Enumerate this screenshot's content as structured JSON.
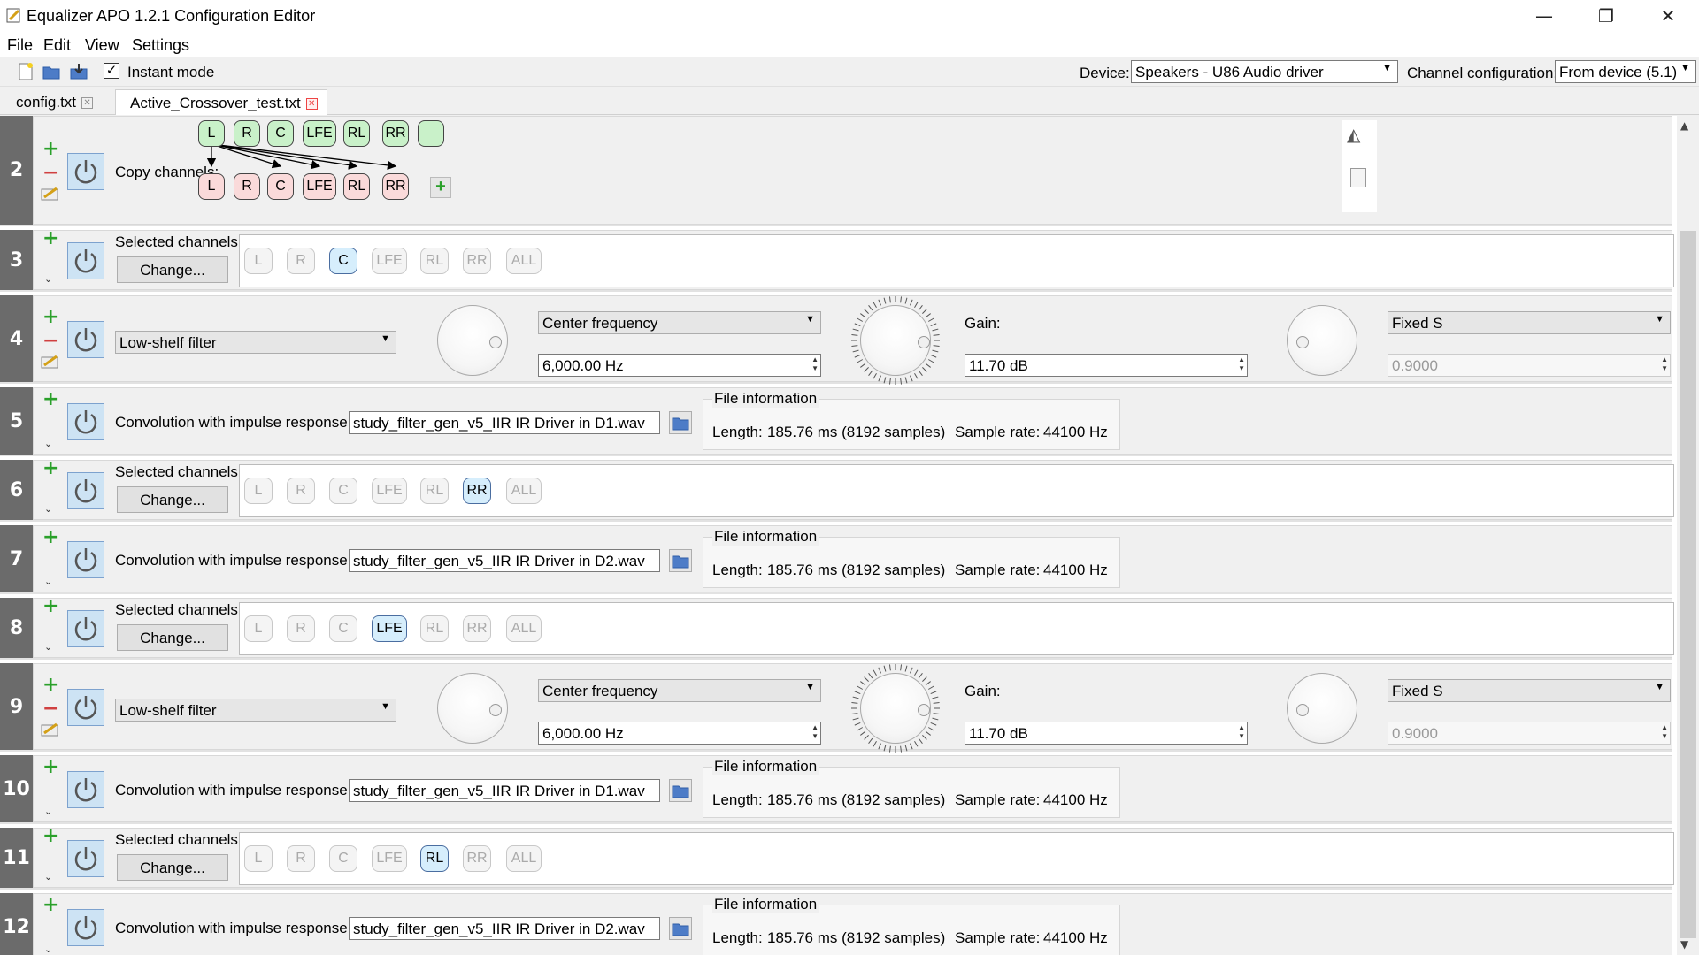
{
  "window": {
    "title": "Equalizer APO 1.2.1 Configuration Editor"
  },
  "menu": [
    "File",
    "Edit",
    "View",
    "Settings"
  ],
  "toolbar": {
    "instant_mode_label": "Instant mode",
    "instant_mode_checked": "✓",
    "device_label": "Device:",
    "device_value": "Speakers - U86 Audio driver",
    "channel_config_label": "Channel configuration:",
    "channel_config_value": "From device (5.1)"
  },
  "tabs": [
    {
      "label": "config.txt",
      "active": false
    },
    {
      "label": "Active_Crossover_test.txt",
      "active": true
    }
  ],
  "filters": [
    {
      "num": "2",
      "type": "copy",
      "label": "Copy channels:",
      "sources": [
        "L",
        "R",
        "C",
        "LFE",
        "RL",
        "RR",
        ""
      ],
      "targets": [
        "L",
        "R",
        "C",
        "LFE",
        "RL",
        "RR"
      ]
    },
    {
      "num": "3",
      "type": "select",
      "label": "Selected channels:",
      "button": "Change...",
      "selected": "C"
    },
    {
      "num": "4",
      "type": "eq",
      "filter_type": "Low-shelf filter",
      "freq_mode": "Center frequency",
      "freq_value": "6,000.00 Hz",
      "gain_label": "Gain:",
      "gain_value": "11.70 dB",
      "q_mode": "Fixed S",
      "q_value": "0.9000"
    },
    {
      "num": "5",
      "type": "conv",
      "label": "Convolution with impulse response:",
      "file": "study_filter_gen_v5_IIR IR Driver in D1.wav",
      "info_title": "File information",
      "length_label": "Length:",
      "length_value": "185.76 ms (8192 samples)",
      "rate_label": "Sample rate:",
      "rate_value": "44100 Hz"
    },
    {
      "num": "6",
      "type": "select",
      "label": "Selected channels:",
      "button": "Change...",
      "selected": "RR"
    },
    {
      "num": "7",
      "type": "conv",
      "label": "Convolution with impulse response:",
      "file": "study_filter_gen_v5_IIR IR Driver in D2.wav",
      "info_title": "File information",
      "length_label": "Length:",
      "length_value": "185.76 ms (8192 samples)",
      "rate_label": "Sample rate:",
      "rate_value": "44100 Hz"
    },
    {
      "num": "8",
      "type": "select",
      "label": "Selected channels:",
      "button": "Change...",
      "selected": "LFE"
    },
    {
      "num": "9",
      "type": "eq",
      "filter_type": "Low-shelf filter",
      "freq_mode": "Center frequency",
      "freq_value": "6,000.00 Hz",
      "gain_label": "Gain:",
      "gain_value": "11.70 dB",
      "q_mode": "Fixed S",
      "q_value": "0.9000"
    },
    {
      "num": "10",
      "type": "conv",
      "label": "Convolution with impulse response:",
      "file": "study_filter_gen_v5_IIR IR Driver in D1.wav",
      "info_title": "File information",
      "length_label": "Length:",
      "length_value": "185.76 ms (8192 samples)",
      "rate_label": "Sample rate:",
      "rate_value": "44100 Hz"
    },
    {
      "num": "11",
      "type": "select",
      "label": "Selected channels:",
      "button": "Change...",
      "selected": "RL"
    },
    {
      "num": "12",
      "type": "conv",
      "label": "Convolution with impulse response:",
      "file": "study_filter_gen_v5_IIR IR Driver in D2.wav",
      "info_title": "File information",
      "length_label": "Length:",
      "length_value": "185.76 ms (8192 samples)",
      "rate_label": "Sample rate:",
      "rate_value": "44100 Hz"
    }
  ],
  "channel_names": [
    "L",
    "R",
    "C",
    "LFE",
    "RL",
    "RR",
    "ALL"
  ],
  "colors": {
    "row_number_bg": "#6b6b6b",
    "selected_channel": "#d6eefc",
    "source_channel": "#c9f1c9",
    "target_channel": "#fadada"
  }
}
